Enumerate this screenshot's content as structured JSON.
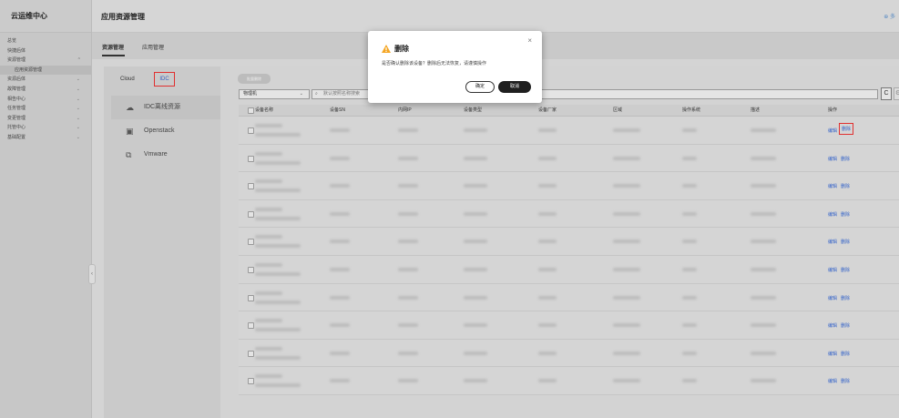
{
  "app": {
    "brand": "云运维中心",
    "page_title": "应用资源管理",
    "header_right": "⊕ 多"
  },
  "sidebar": {
    "items": [
      {
        "label": "总览",
        "chev": ""
      },
      {
        "label": "快捷后体",
        "chev": ""
      },
      {
        "label": "资源管理",
        "chev": "^"
      },
      {
        "label": "应用资源管理",
        "chev": "",
        "sub": true
      },
      {
        "label": "资源后体",
        "chev": "⌄"
      },
      {
        "label": "故障管理",
        "chev": "⌄"
      },
      {
        "label": "相告中心",
        "chev": "⌄"
      },
      {
        "label": "任务管理",
        "chev": "⌄"
      },
      {
        "label": "变更管理",
        "chev": "⌄"
      },
      {
        "label": "托管中心",
        "chev": "⌄"
      },
      {
        "label": "基础配置",
        "chev": "⌄"
      }
    ],
    "collapse": "‹"
  },
  "tabs": {
    "resource": "资源管理",
    "app": "应用管理"
  },
  "subtabs": {
    "cloud": "Cloud",
    "idc": "IDC"
  },
  "resources": [
    {
      "label": "IDC离线资源",
      "icon": "cloud-server-icon"
    },
    {
      "label": "Openstack",
      "icon": "openstack-icon"
    },
    {
      "label": "Vmware",
      "icon": "vmware-icon"
    }
  ],
  "toolbar": {
    "bulk": "批量删除",
    "select_value": "物理机",
    "search_placeholder": "默认按照名称搜索",
    "refresh": "C",
    "settings": "⚙"
  },
  "table": {
    "headers": [
      "设备名称",
      "设备SN",
      "内网IP",
      "设备类型",
      "设备厂家",
      "区域",
      "操作系统",
      "描述",
      "操作"
    ],
    "edit": "编辑",
    "delete": "删除",
    "row_count": 10
  },
  "dialog": {
    "title": "删除",
    "message": "是否确认删除该设备？删除后无法恢复，请谨慎操作",
    "close": "×",
    "ok": "确定",
    "cancel": "取消"
  },
  "colors": {
    "accent": "#3463c9",
    "highlight": "#e03030",
    "warning": "#f5a623"
  }
}
